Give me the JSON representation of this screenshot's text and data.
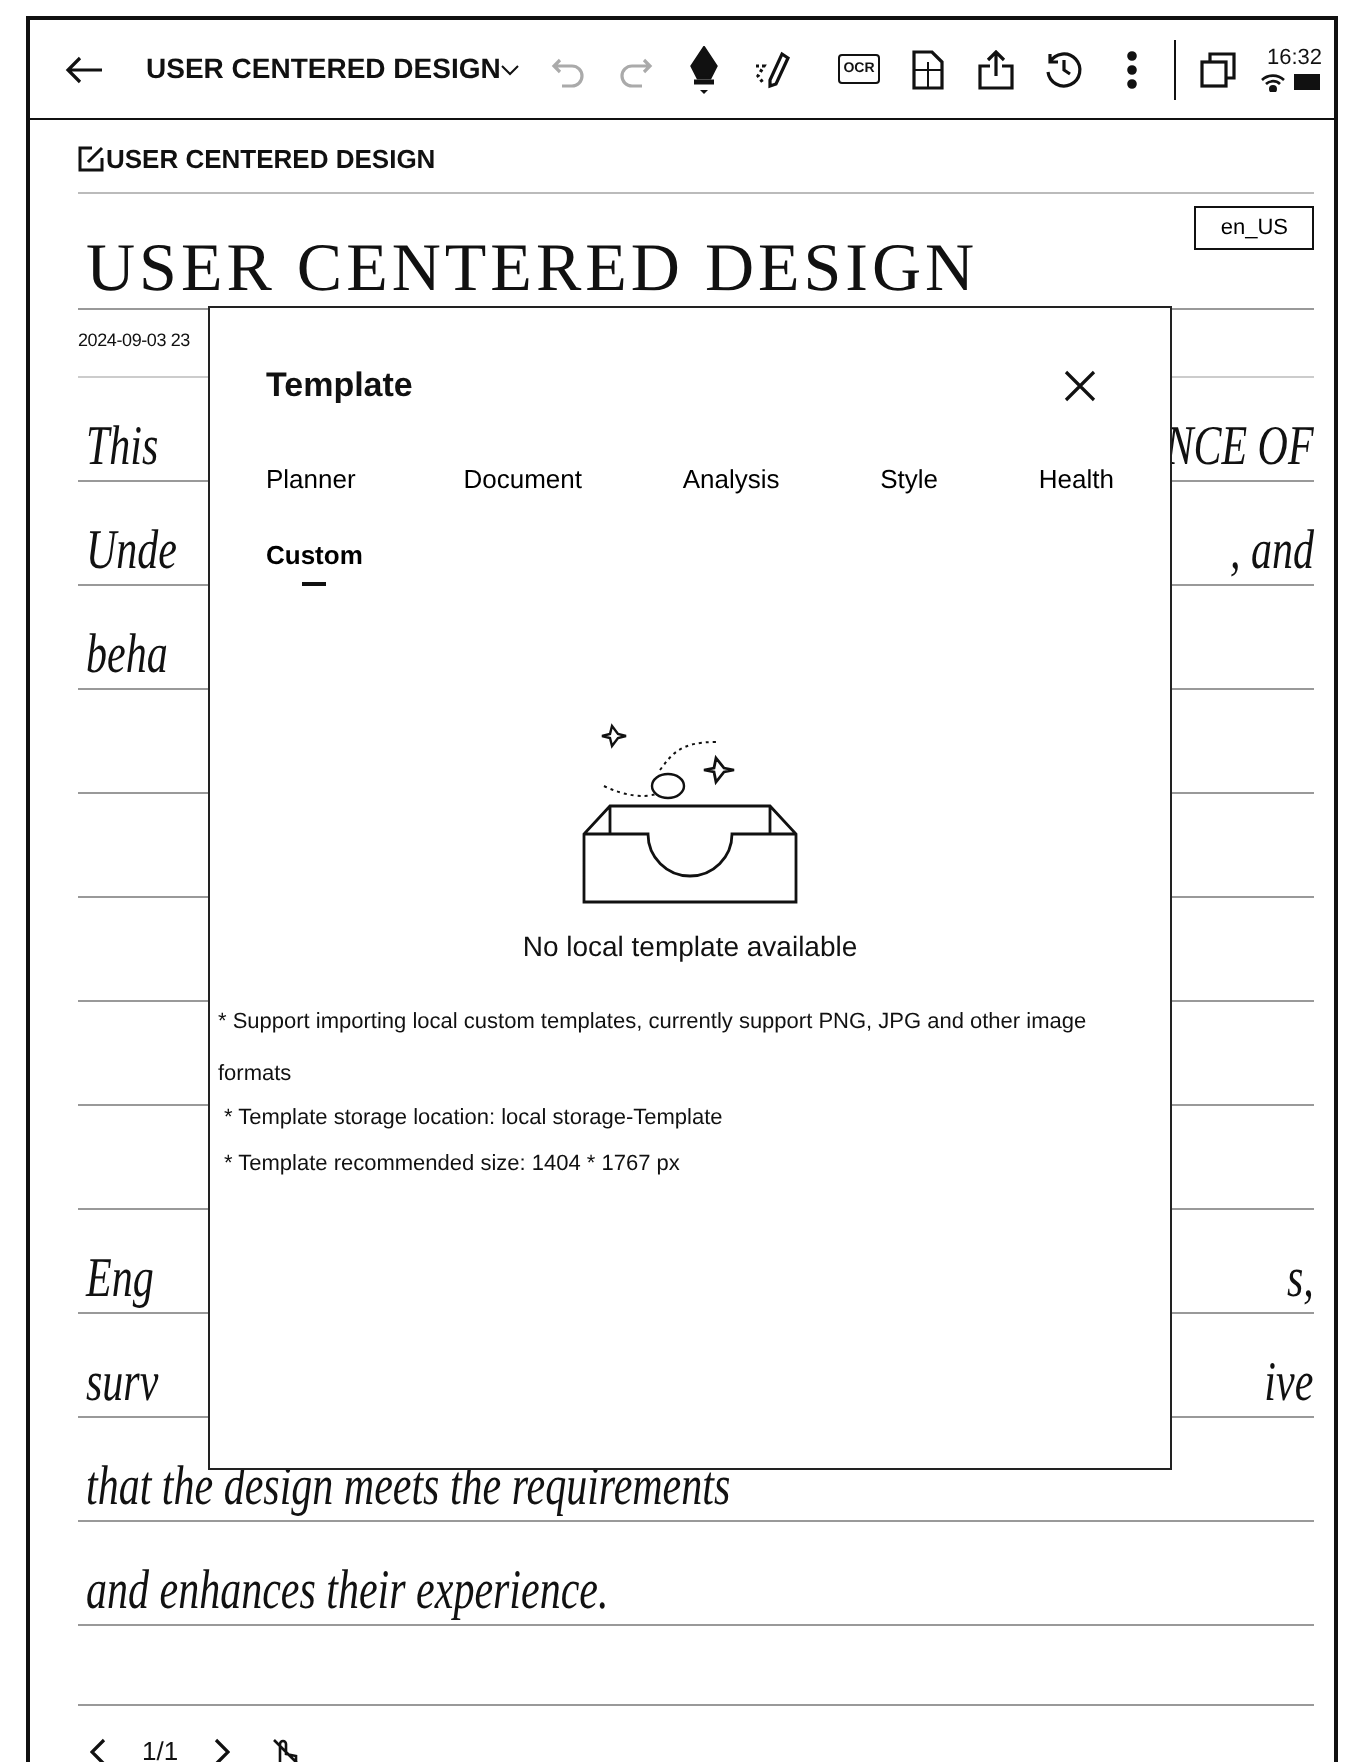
{
  "toolbar": {
    "title": "USER CENTERED DESIGN",
    "undo": {
      "disabled": true
    },
    "redo": {
      "disabled": true
    },
    "ocr_label": "OCR",
    "time": "16:32"
  },
  "note": {
    "title": "USER CENTERED DESIGN",
    "language": "en_US",
    "heading": "USER CENTERED DESIGN",
    "date": "2024-09-03 23",
    "lines": [
      {
        "kind": "text",
        "left": "This",
        "right": "NCE OF"
      },
      {
        "kind": "text",
        "left": "Unde",
        "right": ", and"
      },
      {
        "kind": "text",
        "left": "beha"
      },
      {
        "kind": "blank"
      },
      {
        "kind": "blank"
      },
      {
        "kind": "blank"
      },
      {
        "kind": "blank"
      },
      {
        "kind": "blank"
      },
      {
        "kind": "text",
        "left": "Eng",
        "right": "s,"
      },
      {
        "kind": "text",
        "left": "surv",
        "right": "ive"
      },
      {
        "kind": "text",
        "left": "that  the design meets the requirements"
      },
      {
        "kind": "text",
        "left": "and enhances their experience."
      },
      {
        "kind": "blank"
      }
    ]
  },
  "dialog": {
    "title": "Template",
    "tabs": [
      {
        "label": "Planner",
        "selected": false
      },
      {
        "label": "Document",
        "selected": false
      },
      {
        "label": "Analysis",
        "selected": false
      },
      {
        "label": "Style",
        "selected": false
      },
      {
        "label": "Health",
        "selected": false
      },
      {
        "label": "Custom",
        "selected": true
      }
    ],
    "empty_message": "No local template available",
    "notes": [
      "* Support importing local custom templates, currently support PNG, JPG and other image formats",
      "* Template storage location: local storage-Template",
      "* Template recommended size: 1404 * 1767 px"
    ]
  },
  "footer": {
    "page": "1/1"
  }
}
